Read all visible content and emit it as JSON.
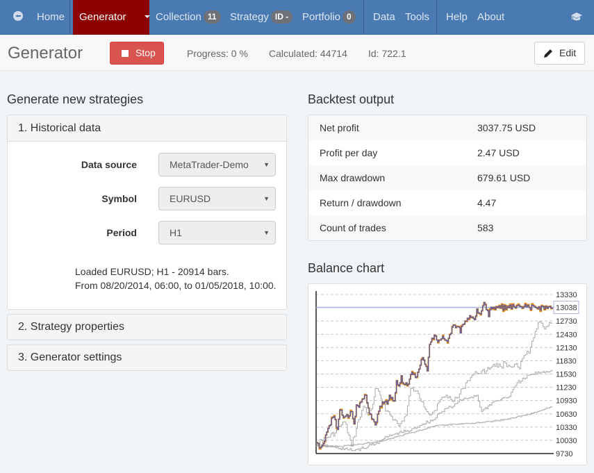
{
  "nav": {
    "home": "Home",
    "generator": "Generator",
    "collection": "Collection",
    "collection_badge": "11",
    "strategy": "Strategy",
    "strategy_badge": "ID -",
    "portfolio": "Portfolio",
    "portfolio_badge": "0",
    "data": "Data",
    "tools": "Tools",
    "help": "Help",
    "about": "About",
    "colors": {
      "bar": "#4a7ab2",
      "active": "#8c0000"
    }
  },
  "subheader": {
    "title": "Generator",
    "stop_label": "Stop",
    "progress": "Progress: 0 %",
    "calculated": "Calculated: 44714",
    "id": "Id: 722.1",
    "edit_label": "Edit"
  },
  "generate": {
    "title": "Generate new strategies",
    "panels": [
      {
        "label": "1. Historical data"
      },
      {
        "label": "2. Strategy properties"
      },
      {
        "label": "3. Generator settings"
      }
    ],
    "fields": [
      {
        "label": "Data source",
        "value": "MetaTrader-Demo"
      },
      {
        "label": "Symbol",
        "value": "EURUSD"
      },
      {
        "label": "Period",
        "value": "H1"
      }
    ],
    "loaded_line1": "Loaded EURUSD; H1 - 20914 bars.",
    "loaded_line2": "From 08/20/2014, 06:00, to 01/05/2018, 10:00."
  },
  "backtest": {
    "title": "Backtest output",
    "rows": [
      {
        "key": "Net profit",
        "value": "3037.75 USD"
      },
      {
        "key": "Profit per day",
        "value": "2.47 USD"
      },
      {
        "key": "Max drawdown",
        "value": "679.61 USD"
      },
      {
        "key": "Return / drawdown",
        "value": "4.47"
      },
      {
        "key": "Count of trades",
        "value": "583"
      }
    ]
  },
  "balance": {
    "title": "Balance chart"
  },
  "chart_data": {
    "type": "line",
    "title": "Balance chart",
    "xlabel": "",
    "ylabel": "",
    "ylim": [
      9730,
      13330
    ],
    "y_ticks": [
      13330,
      12730,
      12430,
      12130,
      11830,
      11530,
      11230,
      10930,
      10630,
      10330,
      10030,
      9730
    ],
    "current_value": 13038,
    "current_label": "13038",
    "grid": true,
    "x_range": [
      0,
      100
    ],
    "series": [
      {
        "name": "balance",
        "color": "#5b5b9e",
        "x": [
          0,
          2,
          3,
          4,
          5,
          6,
          7,
          8,
          9,
          10,
          11,
          12,
          13,
          14,
          15,
          16,
          17,
          18,
          19,
          20,
          21,
          22,
          23,
          24,
          25,
          26,
          27,
          28,
          29,
          30,
          31,
          32,
          33,
          34,
          35,
          36,
          37,
          38,
          39,
          40,
          41,
          42,
          43,
          44,
          45,
          46,
          47,
          48,
          49,
          50,
          51,
          52,
          53,
          54,
          55,
          56,
          57,
          58,
          59,
          60,
          61,
          62,
          63,
          64,
          65,
          66,
          67,
          68,
          69,
          70,
          71,
          72,
          73,
          74,
          75,
          76,
          77,
          78,
          79,
          80,
          81,
          82,
          83,
          84,
          85,
          86,
          87,
          88,
          89,
          90,
          91,
          92,
          93,
          94,
          95,
          96,
          97,
          98,
          99,
          100
        ],
        "y": [
          9980,
          9870,
          9960,
          10150,
          10300,
          10380,
          10550,
          10500,
          10280,
          10720,
          10600,
          10560,
          10610,
          10580,
          10680,
          10400,
          10830,
          10780,
          10900,
          10970,
          11050,
          10760,
          10620,
          10500,
          10380,
          10620,
          10800,
          10900,
          10900,
          10850,
          11050,
          11000,
          10920,
          11380,
          11260,
          11490,
          11300,
          11330,
          11300,
          11520,
          11520,
          11450,
          11570,
          11730,
          11900,
          11750,
          11600,
          12200,
          12340,
          12410,
          12300,
          12300,
          12330,
          12330,
          12290,
          12340,
          12450,
          12640,
          12580,
          12600,
          12460,
          12650,
          12730,
          12790,
          12850,
          12820,
          12760,
          13000,
          12900,
          12960,
          13150,
          12990,
          12830,
          13040,
          13040,
          13038,
          13038,
          13038,
          13038,
          13038,
          13038,
          13038,
          13038,
          13038,
          13038,
          13038,
          13038,
          13038,
          13038,
          13038,
          13038,
          13038,
          13038,
          13038,
          13038,
          13038,
          13038,
          13038,
          13038,
          13038
        ]
      },
      {
        "name": "balance-overlay",
        "color": "#e08a1e",
        "note": "orange high/low envelope drawn along balance line"
      },
      {
        "name": "gray-1",
        "color": "#aaaaaa",
        "x": [
          0,
          5,
          8,
          10,
          12,
          15,
          17,
          18,
          20,
          22,
          24,
          25,
          27,
          28,
          30,
          33,
          35,
          38,
          40,
          42,
          45,
          48,
          50,
          52,
          55,
          57,
          60,
          62,
          64,
          66,
          68,
          70,
          72,
          75,
          78,
          80,
          82,
          84,
          86,
          88,
          90,
          92,
          94,
          96,
          98,
          100
        ],
        "y": [
          9950,
          10100,
          10200,
          10350,
          10450,
          9900,
          10300,
          10500,
          10800,
          10600,
          10850,
          11200,
          11050,
          10850,
          10700,
          10500,
          10350,
          10600,
          11200,
          11150,
          10900,
          10600,
          10700,
          10900,
          11050,
          10950,
          11000,
          11200,
          11380,
          11500,
          11550,
          11600,
          11600,
          11750,
          11700,
          11780,
          11700,
          11750,
          11650,
          11950,
          12000,
          12350,
          12700,
          12600,
          12620,
          12680
        ]
      },
      {
        "name": "gray-2",
        "color": "#aaaaaa",
        "x": [
          0,
          5,
          10,
          15,
          20,
          22,
          25,
          28,
          30,
          35,
          40,
          45,
          50,
          52,
          55,
          58,
          60,
          62,
          65,
          68,
          70,
          75,
          78,
          80,
          82,
          85,
          88,
          90,
          95,
          100
        ],
        "y": [
          9900,
          9900,
          9850,
          9800,
          9850,
          9900,
          9950,
          10050,
          10100,
          10200,
          10250,
          10400,
          10500,
          10650,
          10750,
          10800,
          10900,
          10950,
          11000,
          11050,
          10680,
          10900,
          10950,
          11000,
          11030,
          11330,
          11420,
          11500,
          11570,
          11620
        ]
      },
      {
        "name": "gray-3",
        "color": "#aaaaaa",
        "x": [
          0,
          10,
          20,
          30,
          40,
          50,
          60,
          70,
          80,
          90,
          95,
          100
        ],
        "y": [
          9900,
          9890,
          9950,
          10050,
          10200,
          10350,
          10400,
          10430,
          10500,
          10620,
          10700,
          10790
        ]
      }
    ]
  }
}
